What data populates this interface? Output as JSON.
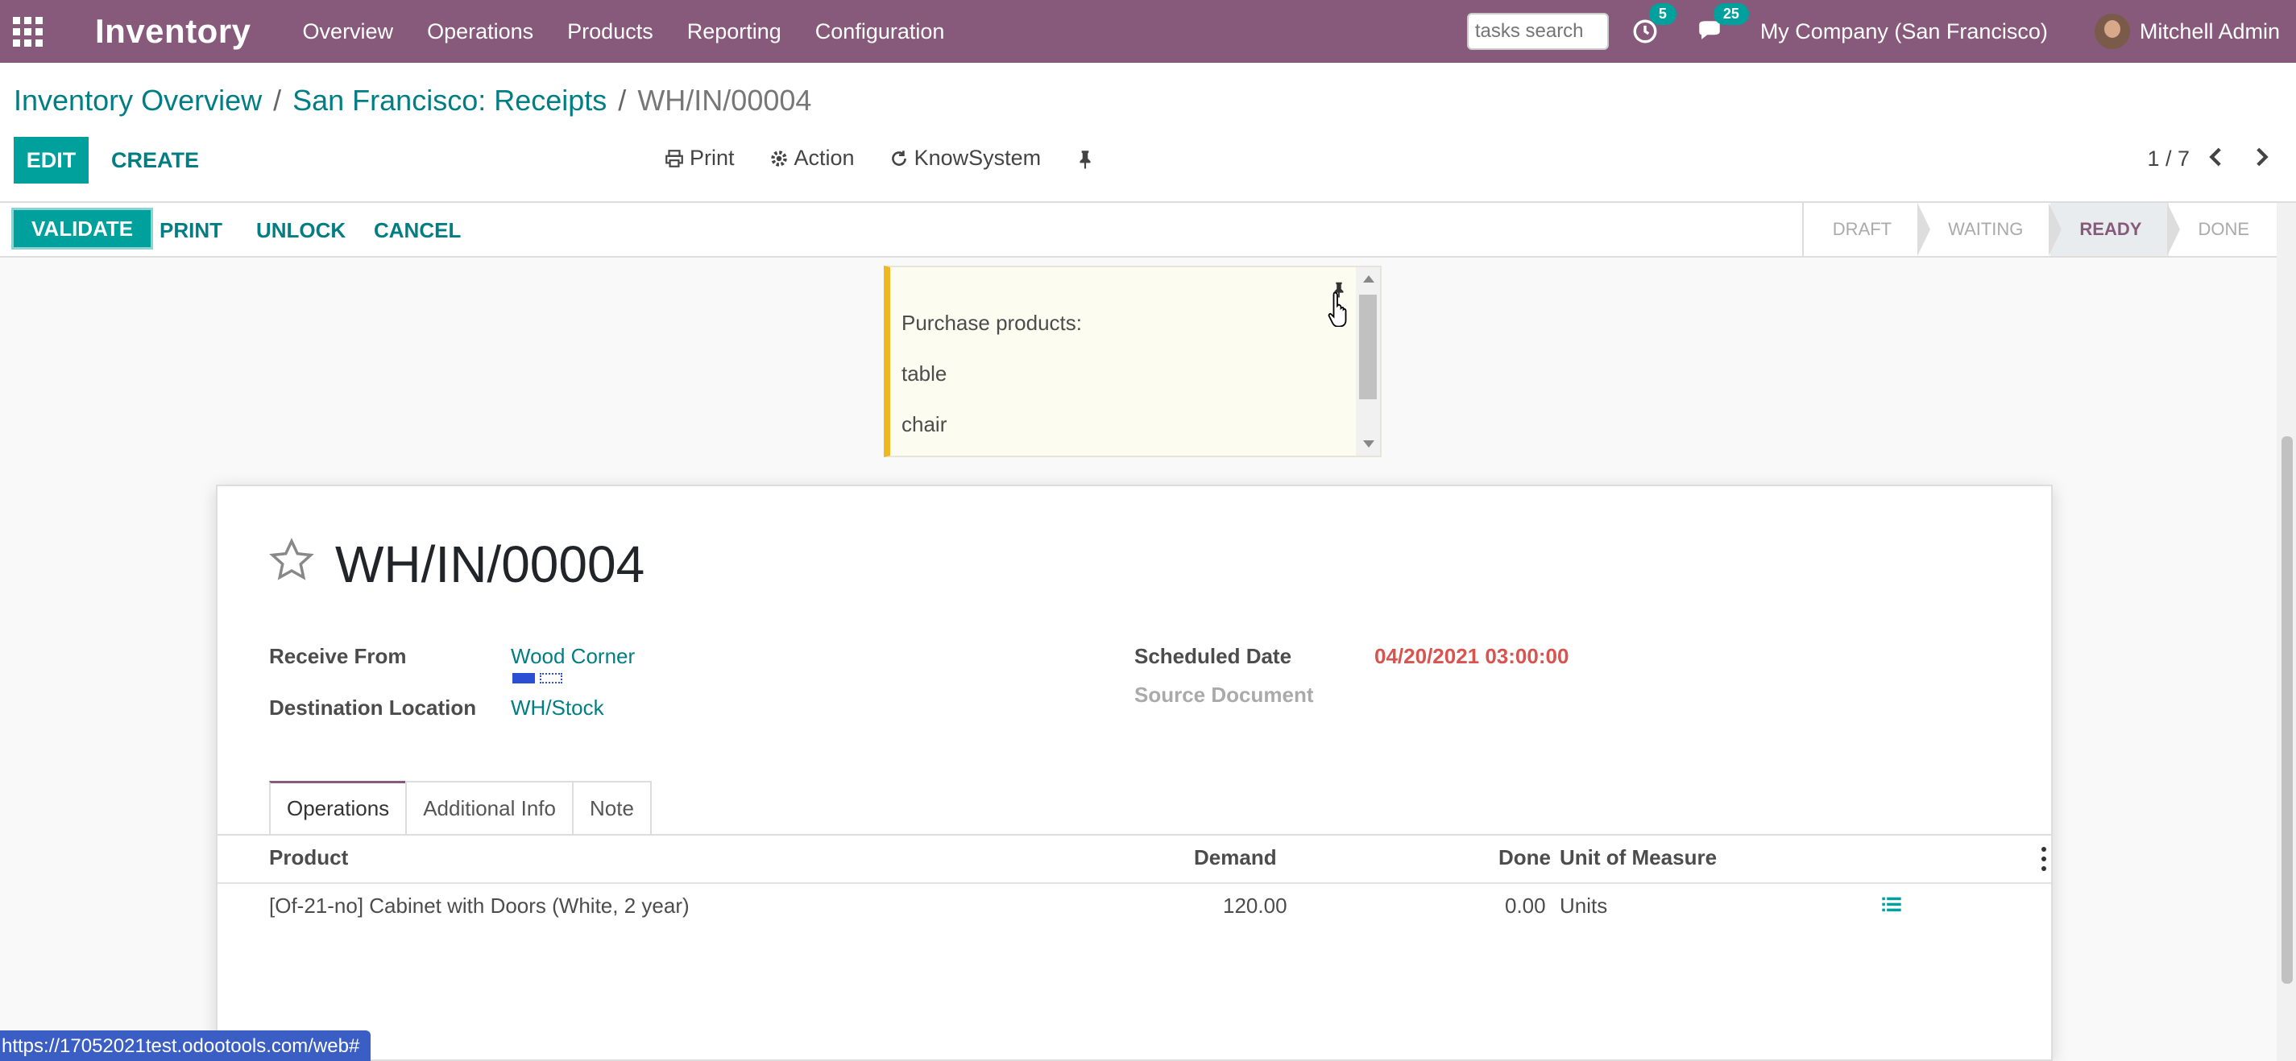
{
  "navbar": {
    "app_name": "Inventory",
    "menu": [
      "Overview",
      "Operations",
      "Products",
      "Reporting",
      "Configuration"
    ],
    "search_placeholder": "tasks search",
    "activity_count": "5",
    "messages_count": "25",
    "company": "My Company (San Francisco)",
    "user": "Mitchell Admin",
    "color": "#875a7b"
  },
  "breadcrumb": {
    "items": [
      "Inventory Overview",
      "San Francisco: Receipts"
    ],
    "current": "WH/IN/00004",
    "separator": "/"
  },
  "buttons": {
    "edit": "EDIT",
    "create": "CREATE"
  },
  "actions": {
    "print": "Print",
    "action": "Action",
    "knowsystem": "KnowSystem"
  },
  "pager": {
    "label": "1 / 7"
  },
  "statusbar": {
    "validate": "VALIDATE",
    "print": "PRINT",
    "unlock": "UNLOCK",
    "cancel": "CANCEL",
    "stages": [
      "DRAFT",
      "WAITING",
      "READY",
      "DONE"
    ],
    "active_stage": "READY"
  },
  "note": {
    "lines": [
      "Purchase products:",
      "table",
      "chair"
    ]
  },
  "form": {
    "name": "WH/IN/00004",
    "receive_from_label": "Receive From",
    "receive_from_value": "Wood Corner",
    "destination_label": "Destination Location",
    "destination_value": "WH/Stock",
    "scheduled_date_label": "Scheduled Date",
    "scheduled_date_value": "04/20/2021 03:00:00",
    "source_document_label": "Source Document"
  },
  "tabs": [
    "Operations",
    "Additional Info",
    "Note"
  ],
  "table": {
    "headers": {
      "product": "Product",
      "demand": "Demand",
      "done": "Done",
      "uom": "Unit of Measure"
    },
    "rows": [
      {
        "product": "[Of-21-no] Cabinet with Doors (White, 2 year)",
        "demand": "120.00",
        "done": "0.00",
        "uom": "Units"
      }
    ]
  },
  "status_url": "https://17052021test.odootools.com/web#",
  "colors": {
    "accent": "#00a09d",
    "link": "#017e84",
    "date": "#d9534f",
    "note_border": "#f0b820"
  }
}
